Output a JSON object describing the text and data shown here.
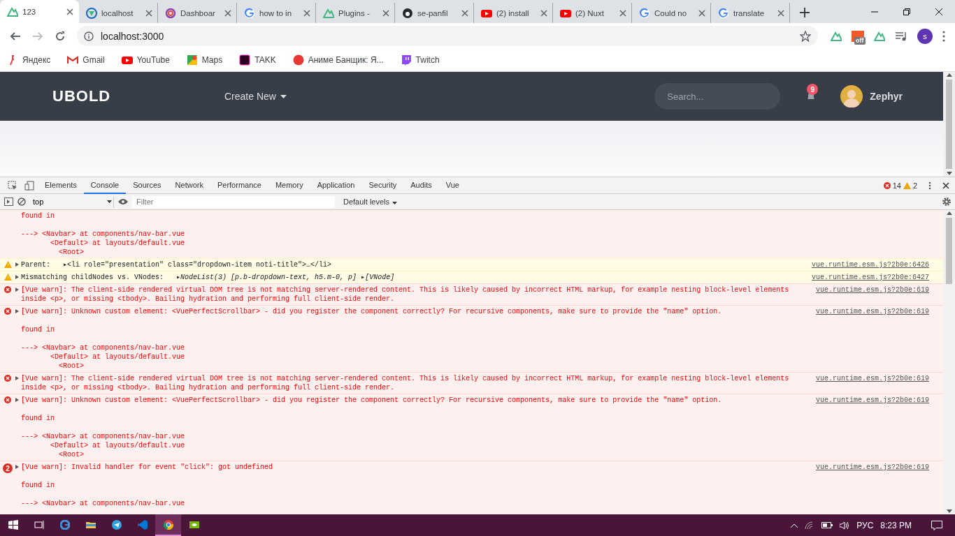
{
  "browser": {
    "tabs": [
      {
        "title": "123",
        "selected": true
      },
      {
        "title": "localhost",
        "selected": false
      },
      {
        "title": "Dashboar",
        "selected": false
      },
      {
        "title": "how to in",
        "selected": false
      },
      {
        "title": "Plugins -",
        "selected": false
      },
      {
        "title": "se-panfil",
        "selected": false
      },
      {
        "title": "(2) install",
        "selected": false
      },
      {
        "title": "(2) Nuxt",
        "selected": false
      },
      {
        "title": "Could no",
        "selected": false
      },
      {
        "title": "translate",
        "selected": false
      }
    ],
    "address": "localhost:3000",
    "extension_badge": "off",
    "profile_initial": "s",
    "bookmarks": [
      {
        "label": "Яндекс"
      },
      {
        "label": "Gmail"
      },
      {
        "label": "YouTube"
      },
      {
        "label": "Maps"
      },
      {
        "label": "TAKK"
      },
      {
        "label": "Аниме Банщик: Я..."
      },
      {
        "label": "Twitch"
      }
    ]
  },
  "page": {
    "logo": "UBOLD",
    "menu": "Create New",
    "search_placeholder": "Search...",
    "notification_count": "9",
    "user": "Zephyr"
  },
  "devtools": {
    "tabs": [
      {
        "label": "Elements",
        "selected": false
      },
      {
        "label": "Console",
        "selected": true
      },
      {
        "label": "Sources",
        "selected": false
      },
      {
        "label": "Network",
        "selected": false
      },
      {
        "label": "Performance",
        "selected": false
      },
      {
        "label": "Memory",
        "selected": false
      },
      {
        "label": "Application",
        "selected": false
      },
      {
        "label": "Security",
        "selected": false
      },
      {
        "label": "Audits",
        "selected": false
      },
      {
        "label": "Vue",
        "selected": false
      }
    ],
    "error_count": "14",
    "warning_count": "2",
    "context": "top",
    "filter_placeholder": "Filter",
    "levels": "Default levels",
    "messages": [
      {
        "kind": "continuation",
        "text": "found in\n\n---> <Navbar> at components/nav-bar.vue\n       <Default> at layouts/default.vue\n         <Root>"
      },
      {
        "kind": "warning",
        "text": "Parent:   ▸<li role=\"presentation\" class=\"dropdown-item noti-title\">…</li>",
        "source": "vue.runtime.esm.js?2b0e:6426"
      },
      {
        "kind": "warning",
        "text": "Mismatching childNodes vs. VNodes:   ▸*NodeList(3) [p.b-dropdown-text, h5.m-0, p]* ▸*[VNode]*",
        "source": "vue.runtime.esm.js?2b0e:6427"
      },
      {
        "kind": "error",
        "text": "[Vue warn]: The client-side rendered virtual DOM tree is not matching server-rendered content. This is likely caused by incorrect HTML markup, for example nesting block-level elements inside <p>, or missing <tbody>. Bailing hydration and performing full client-side render.",
        "source": "vue.runtime.esm.js?2b0e:619"
      },
      {
        "kind": "error",
        "text": "[Vue warn]: Unknown custom element: <VuePerfectScrollbar> - did you register the component correctly? For recursive components, make sure to provide the \"name\" option.\n\nfound in\n\n---> <Navbar> at components/nav-bar.vue\n       <Default> at layouts/default.vue\n         <Root>",
        "source": "vue.runtime.esm.js?2b0e:619"
      },
      {
        "kind": "error",
        "text": "[Vue warn]: The client-side rendered virtual DOM tree is not matching server-rendered content. This is likely caused by incorrect HTML markup, for example nesting block-level elements inside <p>, or missing <tbody>. Bailing hydration and performing full client-side render.",
        "source": "vue.runtime.esm.js?2b0e:619"
      },
      {
        "kind": "error",
        "text": "[Vue warn]: Unknown custom element: <VuePerfectScrollbar> - did you register the component correctly? For recursive components, make sure to provide the \"name\" option.\n\nfound in\n\n---> <Navbar> at components/nav-bar.vue\n       <Default> at layouts/default.vue\n         <Root>",
        "source": "vue.runtime.esm.js?2b0e:619"
      },
      {
        "kind": "error",
        "count": "2",
        "text": "[Vue warn]: Invalid handler for event \"click\": got undefined\n\nfound in\n\n---> <Navbar> at components/nav-bar.vue",
        "source": "vue.runtime.esm.js?2b0e:619"
      }
    ]
  },
  "taskbar": {
    "apps": [
      {
        "selected": false
      },
      {
        "selected": false
      },
      {
        "selected": false
      },
      {
        "selected": false
      },
      {
        "selected": true
      },
      {
        "selected": false
      }
    ],
    "language": "РУС",
    "time": "8:23 PM"
  }
}
